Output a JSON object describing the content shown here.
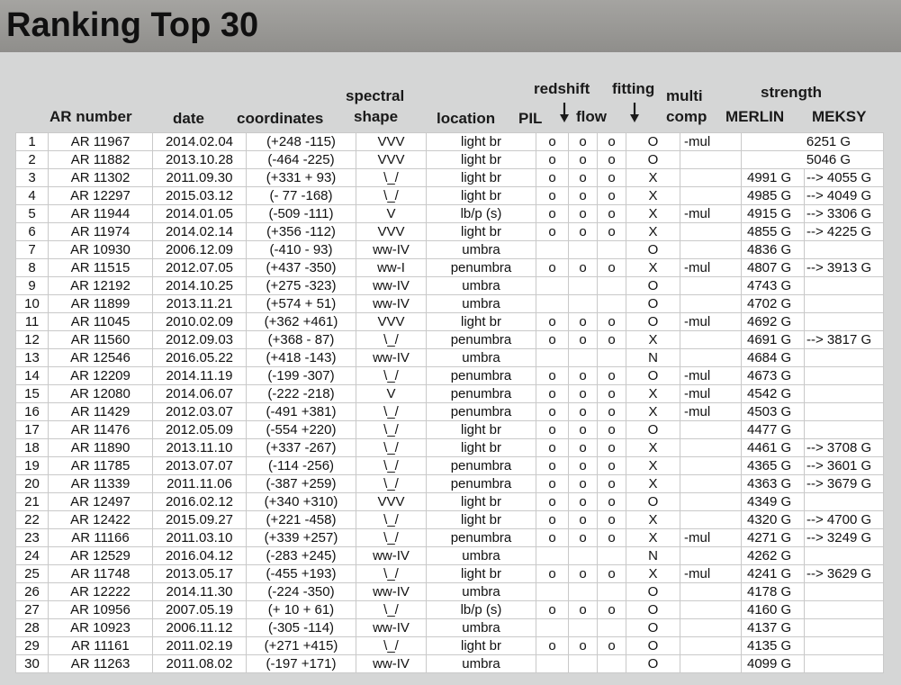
{
  "title": "Ranking Top 30",
  "headers": {
    "ar_number": "AR number",
    "date": "date",
    "coordinates": "coordinates",
    "spectral_line1": "spectral",
    "spectral_line2": "shape",
    "location": "location",
    "pil": "PIL",
    "redshift": "redshift",
    "flow": "flow",
    "fitting": "fitting",
    "multi_line1": "multi",
    "multi_line2": "comp",
    "strength": "strength",
    "merlin": "MERLIN",
    "meksy": "MEKSY"
  },
  "rows": [
    {
      "rank": "1",
      "ar": "AR 11967",
      "date": "2014.02.04",
      "coord": "(+248 -115)",
      "shape": "VVV",
      "loc": "light br",
      "pil": "o",
      "red": "o",
      "flow": "o",
      "fit": "O",
      "multi": "-mul",
      "merged": "6251 G"
    },
    {
      "rank": "2",
      "ar": "AR 11882",
      "date": "2013.10.28",
      "coord": "(-464 -225)",
      "shape": "VVV",
      "loc": "light br",
      "pil": "o",
      "red": "o",
      "flow": "o",
      "fit": "O",
      "multi": "",
      "merged": "5046 G"
    },
    {
      "rank": "3",
      "ar": "AR 11302",
      "date": "2011.09.30",
      "coord": "(+331 + 93)",
      "shape": "\\_/",
      "loc": "light br",
      "pil": "o",
      "red": "o",
      "flow": "o",
      "fit": "X",
      "multi": "",
      "merlin": "4991 G",
      "meksy": "--> 4055 G"
    },
    {
      "rank": "4",
      "ar": "AR 12297",
      "date": "2015.03.12",
      "coord": "(- 77 -168)",
      "shape": "\\_/",
      "loc": "light br",
      "pil": "o",
      "red": "o",
      "flow": "o",
      "fit": "X",
      "multi": "",
      "merlin": "4985 G",
      "meksy": "--> 4049 G"
    },
    {
      "rank": "5",
      "ar": "AR 11944",
      "date": "2014.01.05",
      "coord": "(-509 -111)",
      "shape": "V",
      "loc": "lb/p (s)",
      "pil": "o",
      "red": "o",
      "flow": "o",
      "fit": "X",
      "multi": "-mul",
      "merlin": "4915 G",
      "meksy": "--> 3306 G"
    },
    {
      "rank": "6",
      "ar": "AR 11974",
      "date": "2014.02.14",
      "coord": "(+356 -112)",
      "shape": "VVV",
      "loc": "light br",
      "pil": "o",
      "red": "o",
      "flow": "o",
      "fit": "X",
      "multi": "",
      "merlin": "4855 G",
      "meksy": "--> 4225 G"
    },
    {
      "rank": "7",
      "ar": "AR 10930",
      "date": "2006.12.09",
      "coord": "(-410 - 93)",
      "shape": "ww-IV",
      "loc": "umbra",
      "pil": "",
      "red": "",
      "flow": "",
      "fit": "O",
      "multi": "",
      "merlin": "4836 G",
      "meksy": ""
    },
    {
      "rank": "8",
      "ar": "AR 11515",
      "date": "2012.07.05",
      "coord": "(+437 -350)",
      "shape": "ww-I",
      "loc": "penumbra",
      "pil": "o",
      "red": "o",
      "flow": "o",
      "fit": "X",
      "multi": "-mul",
      "merlin": "4807 G",
      "meksy": "--> 3913 G"
    },
    {
      "rank": "9",
      "ar": "AR 12192",
      "date": "2014.10.25",
      "coord": "(+275 -323)",
      "shape": "ww-IV",
      "loc": "umbra",
      "pil": "",
      "red": "",
      "flow": "",
      "fit": "O",
      "multi": "",
      "merlin": "4743 G",
      "meksy": ""
    },
    {
      "rank": "10",
      "ar": "AR 11899",
      "date": "2013.11.21",
      "coord": "(+574 + 51)",
      "shape": "ww-IV",
      "loc": "umbra",
      "pil": "",
      "red": "",
      "flow": "",
      "fit": "O",
      "multi": "",
      "merlin": "4702 G",
      "meksy": ""
    },
    {
      "rank": "11",
      "ar": "AR 11045",
      "date": "2010.02.09",
      "coord": "(+362 +461)",
      "shape": "VVV",
      "loc": "light br",
      "pil": "o",
      "red": "o",
      "flow": "o",
      "fit": "O",
      "multi": "-mul",
      "merlin": "4692 G",
      "meksy": ""
    },
    {
      "rank": "12",
      "ar": "AR 11560",
      "date": "2012.09.03",
      "coord": "(+368 - 87)",
      "shape": "\\_/",
      "loc": "penumbra",
      "pil": "o",
      "red": "o",
      "flow": "o",
      "fit": "X",
      "multi": "",
      "merlin": "4691 G",
      "meksy": "--> 3817 G"
    },
    {
      "rank": "13",
      "ar": "AR 12546",
      "date": "2016.05.22",
      "coord": "(+418 -143)",
      "shape": "ww-IV",
      "loc": "umbra",
      "pil": "",
      "red": "",
      "flow": "",
      "fit": "N",
      "multi": "",
      "merlin": "4684 G",
      "meksy": ""
    },
    {
      "rank": "14",
      "ar": "AR 12209",
      "date": "2014.11.19",
      "coord": "(-199 -307)",
      "shape": "\\_/",
      "loc": "penumbra",
      "pil": "o",
      "red": "o",
      "flow": "o",
      "fit": "O",
      "multi": "-mul",
      "merlin": "4673 G",
      "meksy": ""
    },
    {
      "rank": "15",
      "ar": "AR 12080",
      "date": "2014.06.07",
      "coord": "(-222 -218)",
      "shape": "V",
      "loc": "penumbra",
      "pil": "o",
      "red": "o",
      "flow": "o",
      "fit": "X",
      "multi": "-mul",
      "merlin": "4542 G",
      "meksy": ""
    },
    {
      "rank": "16",
      "ar": "AR 11429",
      "date": "2012.03.07",
      "coord": "(-491 +381)",
      "shape": "\\_/",
      "loc": "penumbra",
      "pil": "o",
      "red": "o",
      "flow": "o",
      "fit": "X",
      "multi": "-mul",
      "merlin": "4503 G",
      "meksy": ""
    },
    {
      "rank": "17",
      "ar": "AR 11476",
      "date": "2012.05.09",
      "coord": "(-554 +220)",
      "shape": "\\_/",
      "loc": "light br",
      "pil": "o",
      "red": "o",
      "flow": "o",
      "fit": "O",
      "multi": "",
      "merlin": "4477 G",
      "meksy": ""
    },
    {
      "rank": "18",
      "ar": "AR 11890",
      "date": "2013.11.10",
      "coord": "(+337 -267)",
      "shape": "\\_/",
      "loc": "light br",
      "pil": "o",
      "red": "o",
      "flow": "o",
      "fit": "X",
      "multi": "",
      "merlin": "4461 G",
      "meksy": "--> 3708 G"
    },
    {
      "rank": "19",
      "ar": "AR 11785",
      "date": "2013.07.07",
      "coord": "(-114 -256)",
      "shape": "\\_/",
      "loc": "penumbra",
      "pil": "o",
      "red": "o",
      "flow": "o",
      "fit": "X",
      "multi": "",
      "merlin": "4365 G",
      "meksy": "--> 3601 G"
    },
    {
      "rank": "20",
      "ar": "AR 11339",
      "date": "2011.11.06",
      "coord": "(-387 +259)",
      "shape": "\\_/",
      "loc": "penumbra",
      "pil": "o",
      "red": "o",
      "flow": "o",
      "fit": "X",
      "multi": "",
      "merlin": "4363 G",
      "meksy": "--> 3679 G"
    },
    {
      "rank": "21",
      "ar": "AR 12497",
      "date": "2016.02.12",
      "coord": "(+340 +310)",
      "shape": "VVV",
      "loc": "light br",
      "pil": "o",
      "red": "o",
      "flow": "o",
      "fit": "O",
      "multi": "",
      "merlin": "4349 G",
      "meksy": ""
    },
    {
      "rank": "22",
      "ar": "AR 12422",
      "date": "2015.09.27",
      "coord": "(+221 -458)",
      "shape": "\\_/",
      "loc": "light br",
      "pil": "o",
      "red": "o",
      "flow": "o",
      "fit": "X",
      "multi": "",
      "merlin": "4320 G",
      "meksy": "--> 4700 G"
    },
    {
      "rank": "23",
      "ar": "AR 11166",
      "date": "2011.03.10",
      "coord": "(+339 +257)",
      "shape": "\\_/",
      "loc": "penumbra",
      "pil": "o",
      "red": "o",
      "flow": "o",
      "fit": "X",
      "multi": "-mul",
      "merlin": "4271 G",
      "meksy": "--> 3249 G"
    },
    {
      "rank": "24",
      "ar": "AR 12529",
      "date": "2016.04.12",
      "coord": "(-283 +245)",
      "shape": "ww-IV",
      "loc": "umbra",
      "pil": "",
      "red": "",
      "flow": "",
      "fit": "N",
      "multi": "",
      "merlin": "4262 G",
      "meksy": ""
    },
    {
      "rank": "25",
      "ar": "AR 11748",
      "date": "2013.05.17",
      "coord": "(-455 +193)",
      "shape": "\\_/",
      "loc": "light br",
      "pil": "o",
      "red": "o",
      "flow": "o",
      "fit": "X",
      "multi": "-mul",
      "merlin": "4241 G",
      "meksy": "--> 3629 G"
    },
    {
      "rank": "26",
      "ar": "AR 12222",
      "date": "2014.11.30",
      "coord": "(-224 -350)",
      "shape": "ww-IV",
      "loc": "umbra",
      "pil": "",
      "red": "",
      "flow": "",
      "fit": "O",
      "multi": "",
      "merlin": "4178 G",
      "meksy": ""
    },
    {
      "rank": "27",
      "ar": "AR 10956",
      "date": "2007.05.19",
      "coord": "(+ 10 + 61)",
      "shape": "\\_/",
      "loc": "lb/p (s)",
      "pil": "o",
      "red": "o",
      "flow": "o",
      "fit": "O",
      "multi": "",
      "merlin": "4160 G",
      "meksy": ""
    },
    {
      "rank": "28",
      "ar": "AR 10923",
      "date": "2006.11.12",
      "coord": "(-305 -114)",
      "shape": "ww-IV",
      "loc": "umbra",
      "pil": "",
      "red": "",
      "flow": "",
      "fit": "O",
      "multi": "",
      "merlin": "4137 G",
      "meksy": ""
    },
    {
      "rank": "29",
      "ar": "AR 11161",
      "date": "2011.02.19",
      "coord": "(+271 +415)",
      "shape": "\\_/",
      "loc": "light br",
      "pil": "o",
      "red": "o",
      "flow": "o",
      "fit": "O",
      "multi": "",
      "merlin": "4135 G",
      "meksy": ""
    },
    {
      "rank": "30",
      "ar": "AR 11263",
      "date": "2011.08.02",
      "coord": "(-197 +171)",
      "shape": "ww-IV",
      "loc": "umbra",
      "pil": "",
      "red": "",
      "flow": "",
      "fit": "O",
      "multi": "",
      "merlin": "4099 G",
      "meksy": ""
    }
  ]
}
